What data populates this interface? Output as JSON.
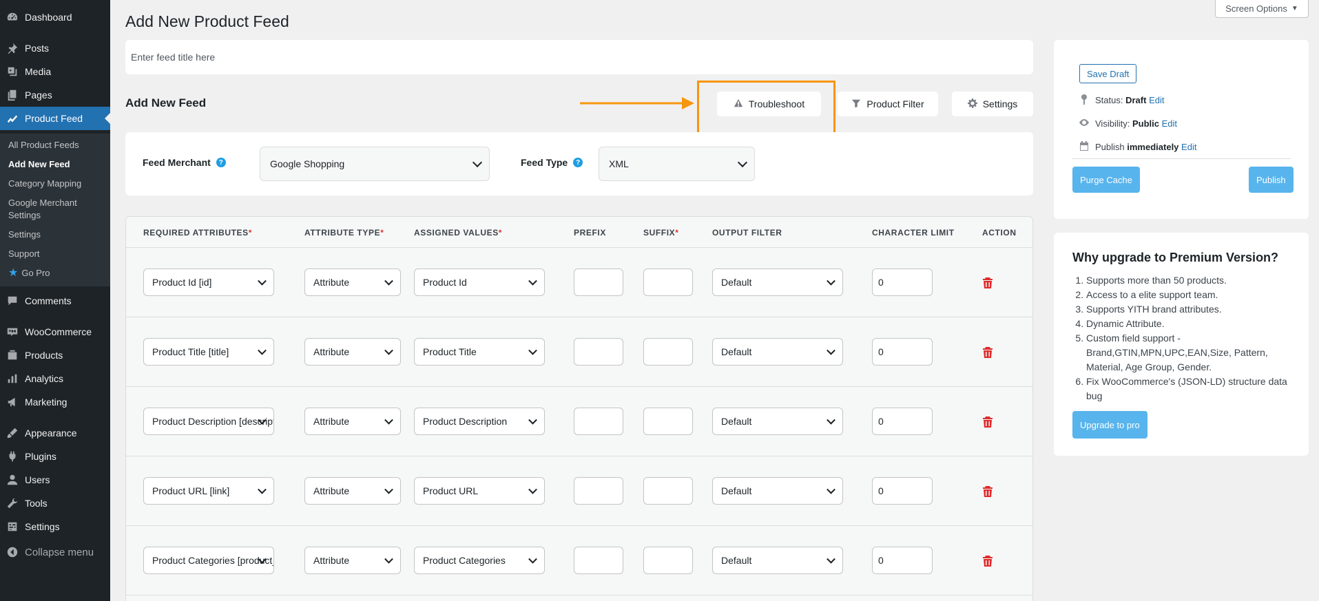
{
  "sidebar": {
    "items": [
      {
        "label": "Dashboard",
        "icon": "dashboard-icon"
      },
      {
        "label": "Posts",
        "icon": "pin-icon"
      },
      {
        "label": "Media",
        "icon": "media-icon"
      },
      {
        "label": "Pages",
        "icon": "pages-icon"
      },
      {
        "label": "Product Feed",
        "icon": "product-feed-icon"
      },
      {
        "label": "Comments",
        "icon": "comments-icon"
      },
      {
        "label": "WooCommerce",
        "icon": "woocommerce-icon"
      },
      {
        "label": "Products",
        "icon": "products-icon"
      },
      {
        "label": "Analytics",
        "icon": "analytics-icon"
      },
      {
        "label": "Marketing",
        "icon": "marketing-icon"
      },
      {
        "label": "Appearance",
        "icon": "appearance-icon"
      },
      {
        "label": "Plugins",
        "icon": "plugins-icon"
      },
      {
        "label": "Users",
        "icon": "users-icon"
      },
      {
        "label": "Tools",
        "icon": "tools-icon"
      },
      {
        "label": "Settings",
        "icon": "settings-icon"
      },
      {
        "label": "Collapse menu",
        "icon": "collapse-icon"
      }
    ],
    "submenu": [
      {
        "label": "All Product Feeds"
      },
      {
        "label": "Add New Feed"
      },
      {
        "label": "Category Mapping"
      },
      {
        "label": "Google Merchant Settings"
      },
      {
        "label": "Settings"
      },
      {
        "label": "Support"
      },
      {
        "label": "Go Pro",
        "icon": "star-icon"
      }
    ]
  },
  "screen_options": "Screen Options",
  "page_title": "Add New Product Feed",
  "title_input": {
    "placeholder": "Enter feed title here",
    "value": ""
  },
  "section_title": "Add New Feed",
  "toolbar": {
    "troubleshoot": "Troubleshoot",
    "product_filter": "Product Filter",
    "settings": "Settings"
  },
  "feed": {
    "merchant_label": "Feed Merchant",
    "merchant_value": "Google Shopping",
    "type_label": "Feed Type",
    "type_value": "XML"
  },
  "table": {
    "headers": {
      "required_attributes": "REQUIRED ATTRIBUTES",
      "attribute_type": "ATTRIBUTE TYPE",
      "assigned_values": "ASSIGNED VALUES",
      "prefix": "PREFIX",
      "suffix": "SUFFIX",
      "output_filter": "OUTPUT FILTER",
      "character_limit": "CHARACTER LIMIT",
      "action": "ACTION"
    },
    "required_mark": "*",
    "rows": [
      {
        "attribute": "Product Id [id]",
        "type": "Attribute",
        "value": "Product Id",
        "prefix": "",
        "suffix": "",
        "filter": "Default",
        "limit": "0"
      },
      {
        "attribute": "Product Title [title]",
        "type": "Attribute",
        "value": "Product Title",
        "prefix": "",
        "suffix": "",
        "filter": "Default",
        "limit": "0"
      },
      {
        "attribute": "Product Description [description]",
        "type": "Attribute",
        "value": "Product Description",
        "prefix": "",
        "suffix": "",
        "filter": "Default",
        "limit": "0"
      },
      {
        "attribute": "Product URL [link]",
        "type": "Attribute",
        "value": "Product URL",
        "prefix": "",
        "suffix": "",
        "filter": "Default",
        "limit": "0"
      },
      {
        "attribute": "Product Categories [product_type]",
        "type": "Attribute",
        "value": "Product Categories",
        "prefix": "",
        "suffix": "",
        "filter": "Default",
        "limit": "0"
      }
    ]
  },
  "publish": {
    "save_draft": "Save Draft",
    "status_label": "Status:",
    "status_value": "Draft",
    "visibility_label": "Visibility:",
    "visibility_value": "Public",
    "publish_label": "Publish",
    "publish_value": "immediately",
    "edit": "Edit",
    "purge_cache": "Purge Cache",
    "publish_button": "Publish"
  },
  "upgrade": {
    "title": "Why upgrade to Premium Version?",
    "items": [
      "Supports more than 50 products.",
      "Access to a elite support team.",
      "Supports YITH brand attributes.",
      "Dynamic Attribute.",
      "Custom field support - Brand,GTIN,MPN,UPC,EAN,Size, Pattern, Material, Age Group, Gender.",
      "Fix WooCommerce's (JSON-LD) structure data bug"
    ],
    "button": "Upgrade to pro"
  },
  "colors": {
    "sidebar_bg": "#1d2327",
    "accent": "#2271b1",
    "highlight": "#f7960e",
    "button_blue": "#58b4ec",
    "danger": "#e02b2b"
  }
}
